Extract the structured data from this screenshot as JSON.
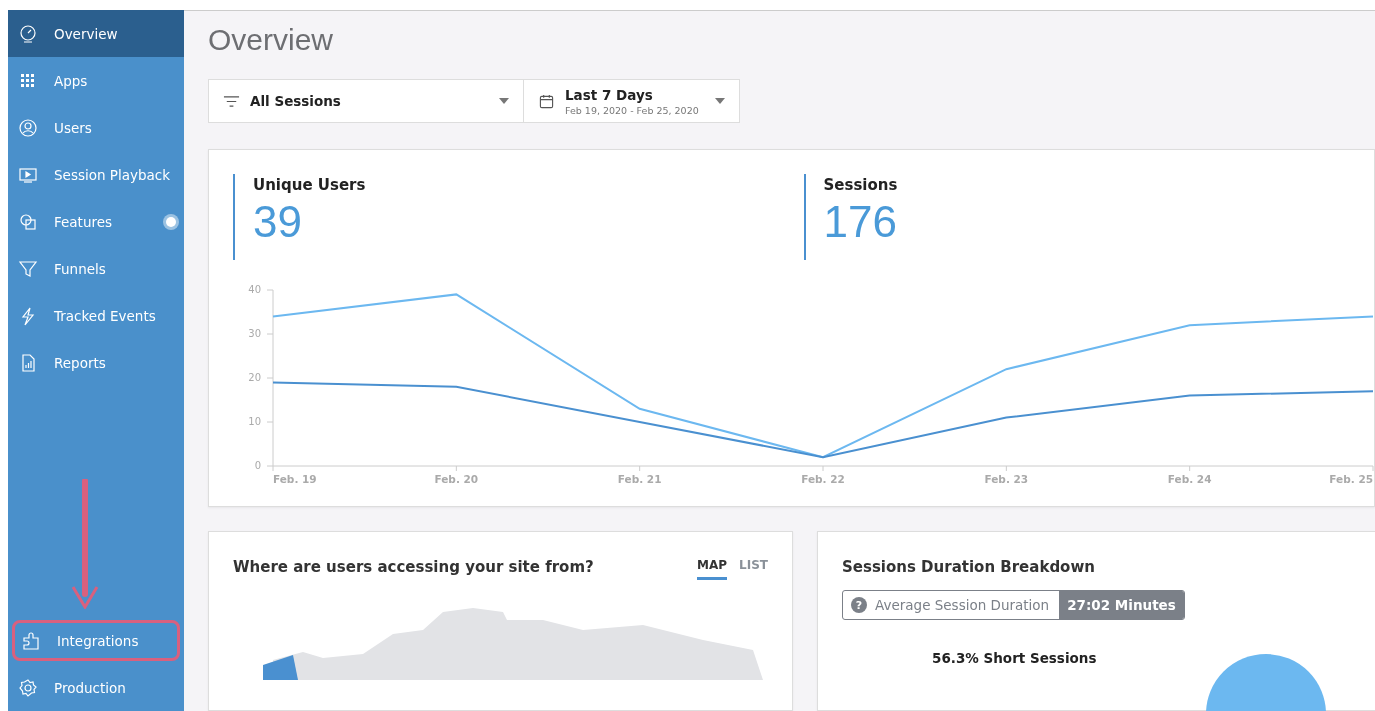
{
  "sidebar": {
    "items": [
      {
        "label": "Overview",
        "selected": true,
        "badge": false,
        "highlighted": false
      },
      {
        "label": "Apps",
        "selected": false,
        "badge": false,
        "highlighted": false
      },
      {
        "label": "Users",
        "selected": false,
        "badge": false,
        "highlighted": false
      },
      {
        "label": "Session Playback",
        "selected": false,
        "badge": false,
        "highlighted": false
      },
      {
        "label": "Features",
        "selected": false,
        "badge": true,
        "highlighted": false
      },
      {
        "label": "Funnels",
        "selected": false,
        "badge": false,
        "highlighted": false
      },
      {
        "label": "Tracked Events",
        "selected": false,
        "badge": false,
        "highlighted": false
      },
      {
        "label": "Reports",
        "selected": false,
        "badge": false,
        "highlighted": false
      }
    ],
    "bottom_items": [
      {
        "label": "Integrations",
        "selected": false,
        "badge": false,
        "highlighted": true
      },
      {
        "label": "Production",
        "selected": false,
        "badge": false,
        "highlighted": false
      }
    ]
  },
  "page_title": "Overview",
  "filters": {
    "segment": "All Sessions",
    "range": "Last 7 Days",
    "range_dates": "Feb 19, 2020 - Feb 25, 2020"
  },
  "stats": [
    {
      "label": "Unique Users",
      "value": "39"
    },
    {
      "label": "Sessions",
      "value": "176"
    }
  ],
  "chart_data": {
    "type": "line",
    "categories": [
      "Feb. 19",
      "Feb. 20",
      "Feb. 21",
      "Feb. 22",
      "Feb. 23",
      "Feb. 24",
      "Feb. 25"
    ],
    "ylim": [
      0,
      40
    ],
    "yticks": [
      0,
      10,
      20,
      30,
      40
    ],
    "series": [
      {
        "color": "#6cb8f0",
        "values": [
          34,
          39,
          13,
          2,
          22,
          32,
          34
        ]
      },
      {
        "color": "#4a90d0",
        "values": [
          19,
          18,
          10,
          2,
          11,
          16,
          17
        ]
      }
    ]
  },
  "map_card": {
    "title": "Where are users accessing your site from?",
    "tabs": [
      {
        "label": "MAP",
        "selected": true
      },
      {
        "label": "LIST",
        "selected": false
      }
    ]
  },
  "duration_card": {
    "title": "Sessions Duration Breakdown",
    "help": "?",
    "metric_label": "Average Session Duration",
    "metric_value": "27:02 Minutes",
    "slice_label": "56.3% Short Sessions"
  }
}
